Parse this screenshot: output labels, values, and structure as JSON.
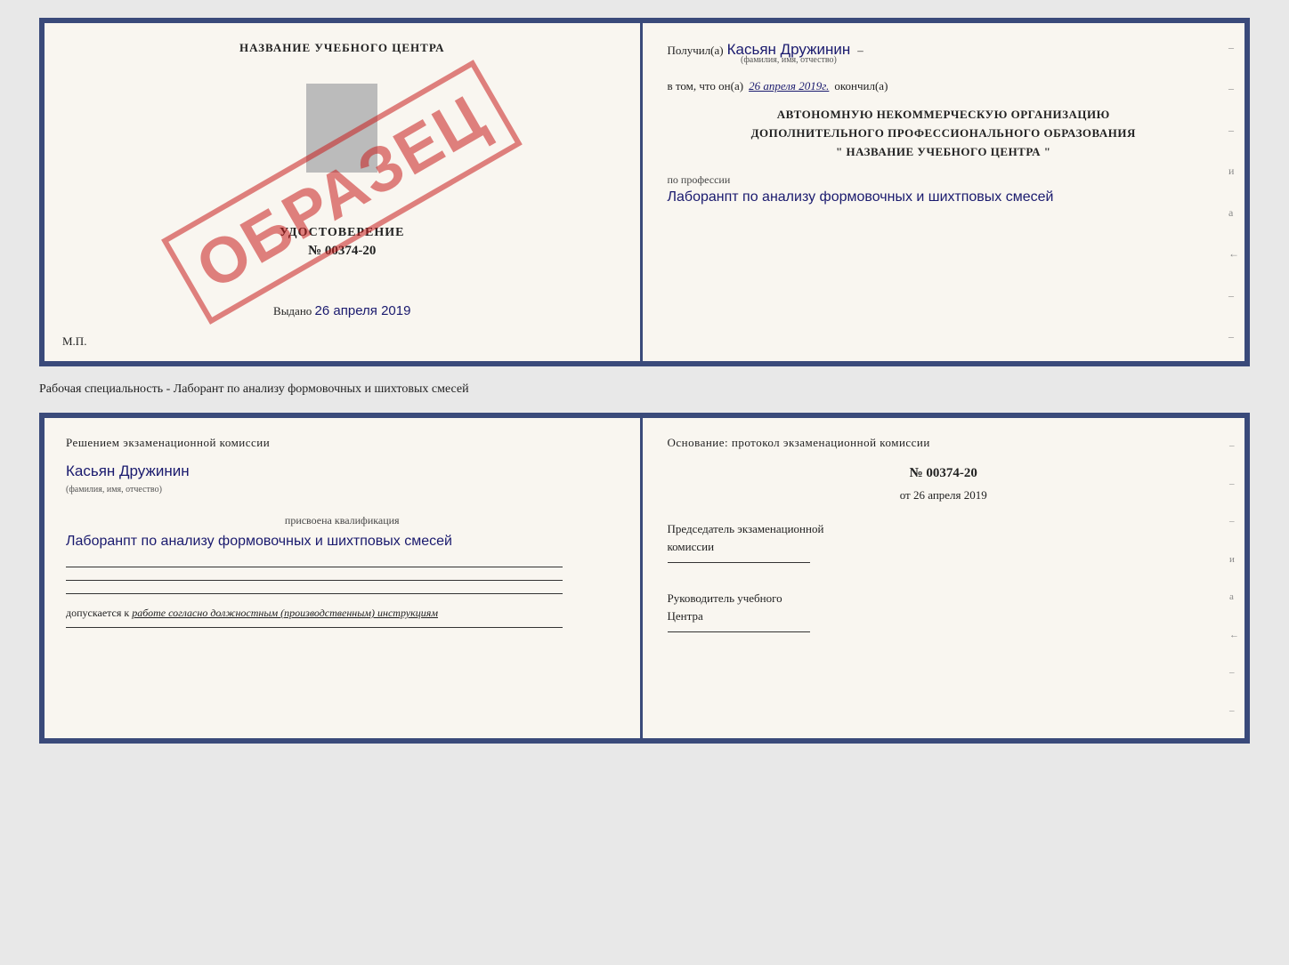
{
  "top_booklet": {
    "left": {
      "center_title": "НАЗВАНИЕ УЧЕБНОГО ЦЕНТРА",
      "obrazets": "ОБРАЗЕЦ",
      "udostoverenie_label": "УДОСТОВЕРЕНИЕ",
      "udostoverenie_number": "№ 00374-20",
      "vydano_prefix": "Выдано",
      "vydano_date": "26 апреля 2019",
      "mp_label": "М.П."
    },
    "right": {
      "poluchil_prefix": "Получил(а)",
      "poluchil_name": "Касьян Дружинин",
      "fio_label": "(фамилия, имя, отчество)",
      "vtom_prefix": "в том, что он(а)",
      "vtom_date": "26 апреля 2019г.",
      "okonchil": "окончил(а)",
      "org_line1": "АВТОНОМНУЮ НЕКОММЕРЧЕСКУЮ ОРГАНИЗАЦИЮ",
      "org_line2": "ДОПОЛНИТЕЛЬНОГО ПРОФЕССИОНАЛЬНОГО ОБРАЗОВАНИЯ",
      "org_line3": "\"    НАЗВАНИЕ УЧЕБНОГО ЦЕНТРА    \"",
      "po_professii_label": "по профессии",
      "po_professii_value": "Лаборанпт по анализу формовочных и шихтповых смесей",
      "side_dashes": [
        "-",
        "-",
        "-",
        "и",
        "а",
        "←",
        "-",
        "-"
      ]
    }
  },
  "middle_caption": "Рабочая специальность - Лаборант по анализу формовочных и шихтовых смесей",
  "bottom_booklet": {
    "left": {
      "resheniem_line": "Решением  экзаменационной  комиссии",
      "name_handwritten": "Касьян  Дружинин",
      "fio_label": "(фамилия, имя, отчество)",
      "prisvoena_label": "присвоена квалификация",
      "kvalifikaciya_value": "Лаборанпт по анализу формовочных и шихтповых смесей",
      "dopuskaetsya_prefix": "допускается к",
      "dopuskaetsya_value": "работе согласно должностным (производственным) инструкциям"
    },
    "right": {
      "osnovanie_title": "Основание:  протокол  экзаменационной  комиссии",
      "protokol_number": "№  00374-20",
      "ot_prefix": "от",
      "ot_date": "26 апреля 2019",
      "predsedatel_label1": "Председатель экзаменационной",
      "predsedatel_label2": "комиссии",
      "rukovoditel_label1": "Руководитель учебного",
      "rukovoditel_label2": "Центра",
      "side_marks": [
        "-",
        "-",
        "-",
        "и",
        "а",
        "←",
        "-",
        "-"
      ]
    }
  }
}
